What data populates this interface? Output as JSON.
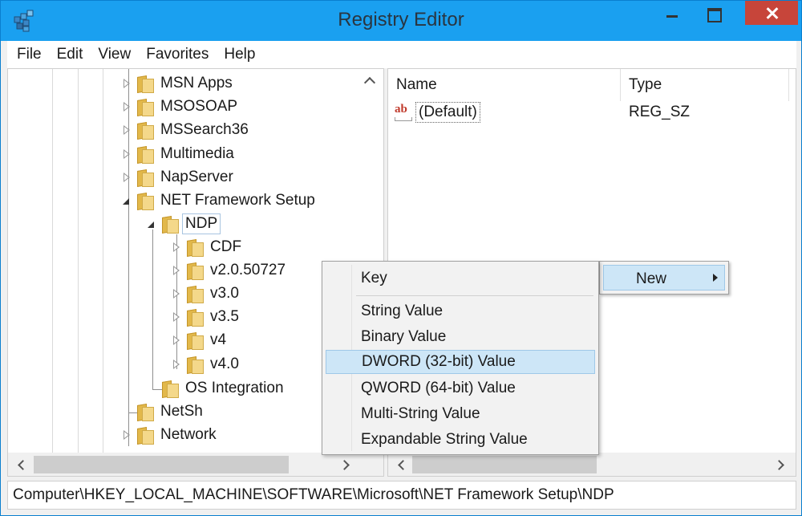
{
  "window": {
    "title": "Registry Editor",
    "icon": "registry-editor-icon"
  },
  "menubar": [
    "File",
    "Edit",
    "View",
    "Favorites",
    "Help"
  ],
  "tree": {
    "items": [
      {
        "label": "MSN Apps",
        "state": "collapsed"
      },
      {
        "label": "MSOSOAP",
        "state": "collapsed"
      },
      {
        "label": "MSSearch36",
        "state": "collapsed"
      },
      {
        "label": "Multimedia",
        "state": "collapsed"
      },
      {
        "label": "NapServer",
        "state": "collapsed"
      },
      {
        "label": "NET Framework Setup",
        "state": "expanded"
      },
      {
        "label": "NDP",
        "state": "expanded",
        "selected": true
      },
      {
        "label": "CDF",
        "state": "collapsed"
      },
      {
        "label": "v2.0.50727",
        "state": "collapsed"
      },
      {
        "label": "v3.0",
        "state": "collapsed"
      },
      {
        "label": "v3.5",
        "state": "collapsed"
      },
      {
        "label": "v4",
        "state": "collapsed"
      },
      {
        "label": "v4.0",
        "state": "collapsed"
      },
      {
        "label": "OS Integration",
        "state": "leaf"
      },
      {
        "label": "NetSh",
        "state": "leaf"
      },
      {
        "label": "Network",
        "state": "collapsed"
      }
    ]
  },
  "list": {
    "columns": [
      "Name",
      "Type"
    ],
    "rows": [
      {
        "icon": "string-value-icon",
        "icon_text": "ab",
        "name": "(Default)",
        "type": "REG_SZ"
      }
    ]
  },
  "context_menu": {
    "parent_item": "New",
    "submenu": {
      "items": [
        "Key",
        "String Value",
        "Binary Value",
        "DWORD (32-bit) Value",
        "QWORD (64-bit) Value",
        "Multi-String Value",
        "Expandable String Value"
      ],
      "highlighted": "DWORD (32-bit) Value"
    }
  },
  "statusbar": {
    "path": "Computer\\HKEY_LOCAL_MACHINE\\SOFTWARE\\Microsoft\\NET Framework Setup\\NDP"
  },
  "colors": {
    "titlebar": "#1aa0f0",
    "close_button": "#c7453a",
    "menu_highlight": "#cde6f7"
  }
}
